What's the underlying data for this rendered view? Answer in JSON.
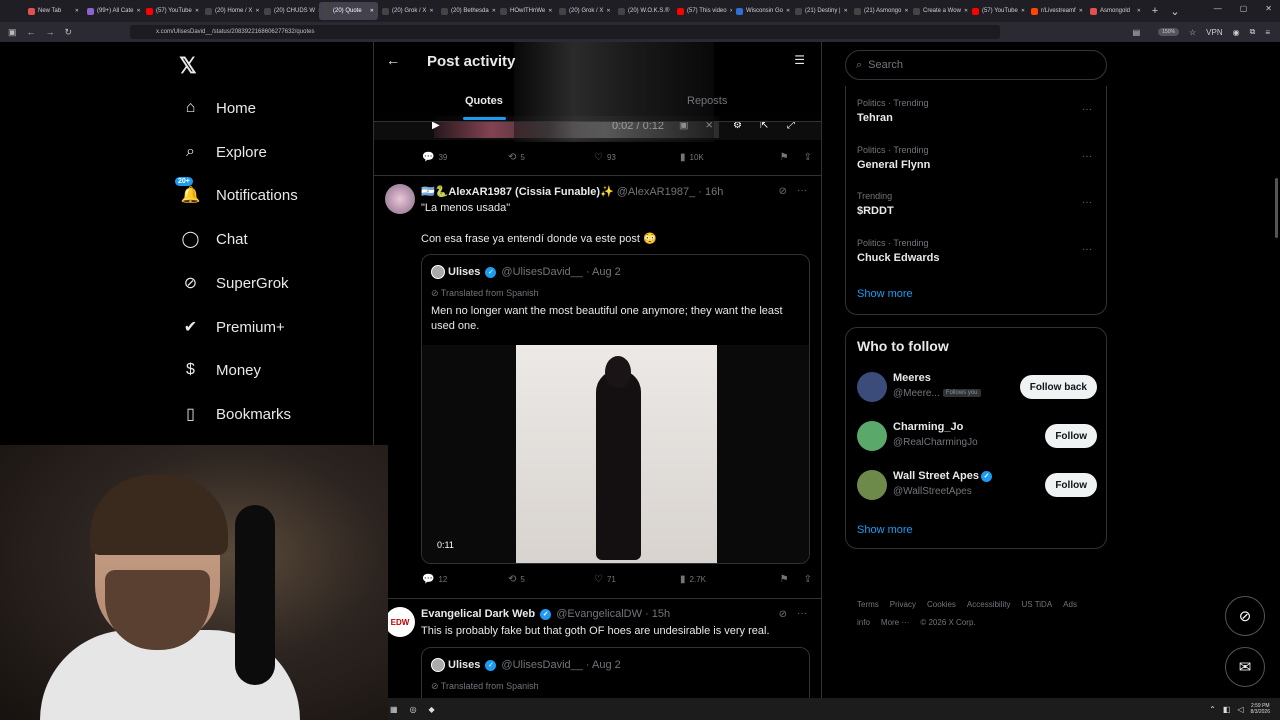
{
  "browser": {
    "tabs": [
      {
        "label": "New Tab",
        "color": "#e25050"
      },
      {
        "label": "(99+) All Cate",
        "color": "#8a63d2"
      },
      {
        "label": "(57) YouTube",
        "color": "#ff0000"
      },
      {
        "label": "(20) Home / X",
        "color": "#444444"
      },
      {
        "label": "(20) CHUDS W",
        "color": "#444444"
      },
      {
        "label": "(20) Quote",
        "color": "#444444",
        "active": true
      },
      {
        "label": "(20) Grok / X",
        "color": "#444444"
      },
      {
        "label": "(20) Bethesda",
        "color": "#444444"
      },
      {
        "label": "HOwITHnWe",
        "color": "#444444"
      },
      {
        "label": "(20) Grok / X",
        "color": "#444444"
      },
      {
        "label": "(20) W.O.K.S.®",
        "color": "#444444"
      },
      {
        "label": "(57) This video",
        "color": "#ff0000"
      },
      {
        "label": "Wisconsin Go",
        "color": "#2f6fd6"
      },
      {
        "label": "(21) Destiny |",
        "color": "#444444"
      },
      {
        "label": "(21) Asmongo",
        "color": "#444444"
      },
      {
        "label": "Create a Wow",
        "color": "#444444"
      },
      {
        "label": "(57) YouTube",
        "color": "#ff0000"
      },
      {
        "label": "r/Livestreamf",
        "color": "#ff4500"
      },
      {
        "label": "Asmongold",
        "color": "#e25050"
      }
    ],
    "url": "x.com/UlisesDavid__/status/2083922168606277632/quotes",
    "zoom": "150%",
    "vpn": "VPN"
  },
  "sidebar": {
    "items": [
      {
        "label": "Home",
        "icon": "home-icon"
      },
      {
        "label": "Explore",
        "icon": "search-icon"
      },
      {
        "label": "Notifications",
        "icon": "bell-icon",
        "badge": "20+"
      },
      {
        "label": "Chat",
        "icon": "chat-icon"
      },
      {
        "label": "SuperGrok",
        "icon": "grok-icon"
      },
      {
        "label": "Premium+",
        "icon": "verified-icon"
      },
      {
        "label": "Money",
        "icon": "dollar-icon"
      },
      {
        "label": "Bookmarks",
        "icon": "bookmark-icon"
      }
    ]
  },
  "header": {
    "title": "Post activity",
    "tabs": [
      "Quotes",
      "Reposts"
    ]
  },
  "video": {
    "time": "0:02 / 0:12"
  },
  "stats1": {
    "replies": "39",
    "reposts": "5",
    "likes": "93",
    "views": "10K"
  },
  "post1": {
    "name": "🇦🇷🐍AlexAR1987 (Cissia Funable)✨",
    "handle": "@AlexAR1987_",
    "time": "· 16h",
    "line1": "\"La menos usada\"",
    "line2": "Con esa frase ya entendí donde va este post 😳",
    "quote": {
      "name": "Ulises",
      "handle": "@UlisesDavid__",
      "time": "· Aug 2",
      "translated": "Translated from Spanish",
      "text": "Men no longer want the most beautiful one anymore; they want the least used one.",
      "duration": "0:11"
    },
    "stats": {
      "replies": "12",
      "reposts": "5",
      "likes": "71",
      "views": "2.7K"
    }
  },
  "post2": {
    "name": "Evangelical Dark Web",
    "handle": "@EvangelicalDW",
    "time": "· 15h",
    "text": "This is probably fake but that goth OF hoes are undesirable is very real.",
    "quote": {
      "name": "Ulises",
      "handle": "@UlisesDavid__",
      "time": "· Aug 2",
      "translated": "Translated from Spanish"
    }
  },
  "search": {
    "placeholder": "Search"
  },
  "trends": [
    {
      "category": "Politics · Trending",
      "title": "Tehran"
    },
    {
      "category": "Politics · Trending",
      "title": "General Flynn"
    },
    {
      "category": "Trending",
      "title": "$RDDT"
    },
    {
      "category": "Politics · Trending",
      "title": "Chuck Edwards"
    }
  ],
  "trends_show_more": "Show more",
  "who_to_follow": {
    "title": "Who to follow",
    "users": [
      {
        "name": "Meeres",
        "handle": "@Meere...",
        "follows_you": "Follows you",
        "button": "Follow back",
        "color": "#3b4b7a"
      },
      {
        "name": "Charming_Jo",
        "handle": "@RealCharmingJo",
        "button": "Follow",
        "color": "#5aa86a"
      },
      {
        "name": "Wall Street Apes",
        "handle": "@WallStreetApes",
        "button": "Follow",
        "color": "#6d8a4a",
        "verified": true
      }
    ],
    "show_more": "Show more"
  },
  "footer": [
    "Terms",
    "Privacy",
    "Cookies",
    "Accessibility",
    "US TiDA",
    "Ads info",
    "More ···",
    "© 2026 X Corp."
  ],
  "taskbar": {
    "time": "2:59 PM",
    "date": "8/3/2026"
  }
}
